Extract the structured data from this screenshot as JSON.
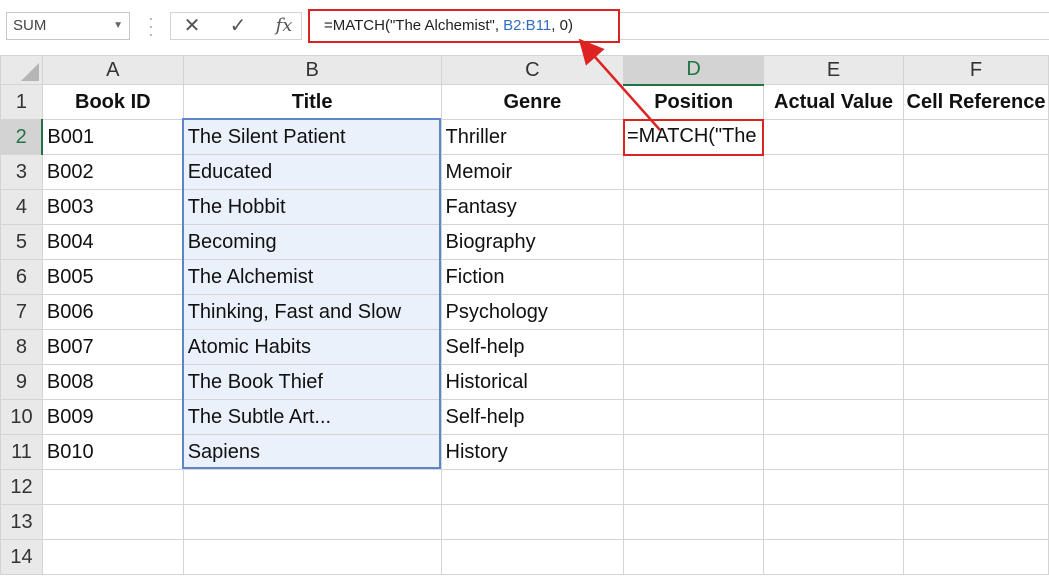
{
  "name_box": {
    "value": "SUM"
  },
  "formula_bar": {
    "cancel_glyph": "✕",
    "enter_glyph": "✓",
    "fx_label": "fx",
    "formula_prefix": "=MATCH(\"The Alchemist\", ",
    "formula_ref": "B2:B11",
    "formula_suffix": ", 0)"
  },
  "columns": [
    "A",
    "B",
    "C",
    "D",
    "E",
    "F"
  ],
  "header_row": [
    "Book ID",
    "Title",
    "Genre",
    "Position",
    "Actual Value",
    "Cell Reference"
  ],
  "rows": [
    {
      "id": "B001",
      "title": "The Silent Patient",
      "genre": "Thriller"
    },
    {
      "id": "B002",
      "title": "Educated",
      "genre": "Memoir"
    },
    {
      "id": "B003",
      "title": "The Hobbit",
      "genre": "Fantasy"
    },
    {
      "id": "B004",
      "title": "Becoming",
      "genre": "Biography"
    },
    {
      "id": "B005",
      "title": "The Alchemist",
      "genre": "Fiction"
    },
    {
      "id": "B006",
      "title": "Thinking, Fast and Slow",
      "genre": "Psychology"
    },
    {
      "id": "B007",
      "title": "Atomic Habits",
      "genre": "Self-help"
    },
    {
      "id": "B008",
      "title": "The Book Thief",
      "genre": "Historical"
    },
    {
      "id": "B009",
      "title": "The Subtle Art...",
      "genre": "Self-help"
    },
    {
      "id": "B010",
      "title": "Sapiens",
      "genre": "History"
    }
  ],
  "row_numbers": [
    "1",
    "2",
    "3",
    "4",
    "5",
    "6",
    "7",
    "8",
    "9",
    "10",
    "11",
    "12",
    "13",
    "14"
  ],
  "active_cell": {
    "address": "D2",
    "display": "=MATCH(\"The"
  },
  "colors": {
    "accent": "#217346",
    "highlight_border": "#dd2222",
    "range_border": "#5b87c8"
  }
}
